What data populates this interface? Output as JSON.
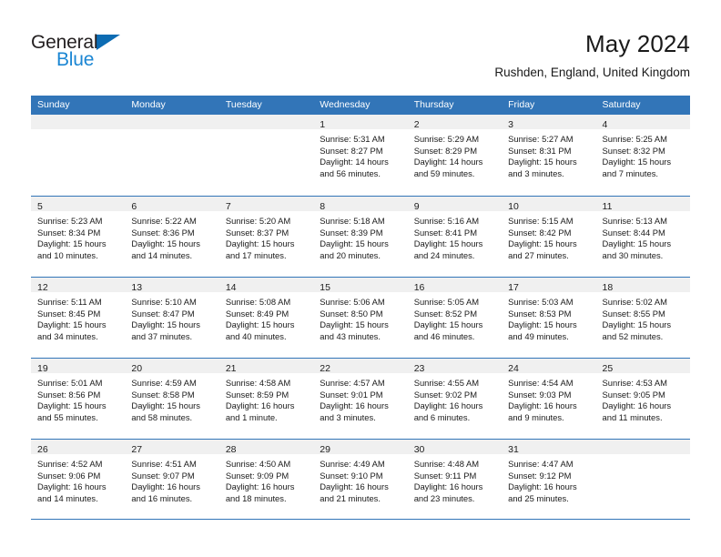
{
  "brand": {
    "line1": "General",
    "line2": "Blue",
    "triangle_color": "#0d6cb3",
    "line2_color": "#1b86d3"
  },
  "header": {
    "title": "May 2024",
    "location": "Rushden, England, United Kingdom"
  },
  "theme": {
    "header_blue": "#3275b8",
    "daynum_band": "#f0f0f0",
    "text": "#1a1a1a"
  },
  "weekday_headers": [
    "Sunday",
    "Monday",
    "Tuesday",
    "Wednesday",
    "Thursday",
    "Friday",
    "Saturday"
  ],
  "weeks": [
    [
      {
        "day": "",
        "sunrise": "",
        "sunset": "",
        "daylight1": "",
        "daylight2": "",
        "empty": true
      },
      {
        "day": "",
        "sunrise": "",
        "sunset": "",
        "daylight1": "",
        "daylight2": "",
        "empty": true
      },
      {
        "day": "",
        "sunrise": "",
        "sunset": "",
        "daylight1": "",
        "daylight2": "",
        "empty": true
      },
      {
        "day": "1",
        "sunrise": "Sunrise: 5:31 AM",
        "sunset": "Sunset: 8:27 PM",
        "daylight1": "Daylight: 14 hours",
        "daylight2": "and 56 minutes."
      },
      {
        "day": "2",
        "sunrise": "Sunrise: 5:29 AM",
        "sunset": "Sunset: 8:29 PM",
        "daylight1": "Daylight: 14 hours",
        "daylight2": "and 59 minutes."
      },
      {
        "day": "3",
        "sunrise": "Sunrise: 5:27 AM",
        "sunset": "Sunset: 8:31 PM",
        "daylight1": "Daylight: 15 hours",
        "daylight2": "and 3 minutes."
      },
      {
        "day": "4",
        "sunrise": "Sunrise: 5:25 AM",
        "sunset": "Sunset: 8:32 PM",
        "daylight1": "Daylight: 15 hours",
        "daylight2": "and 7 minutes."
      }
    ],
    [
      {
        "day": "5",
        "sunrise": "Sunrise: 5:23 AM",
        "sunset": "Sunset: 8:34 PM",
        "daylight1": "Daylight: 15 hours",
        "daylight2": "and 10 minutes."
      },
      {
        "day": "6",
        "sunrise": "Sunrise: 5:22 AM",
        "sunset": "Sunset: 8:36 PM",
        "daylight1": "Daylight: 15 hours",
        "daylight2": "and 14 minutes."
      },
      {
        "day": "7",
        "sunrise": "Sunrise: 5:20 AM",
        "sunset": "Sunset: 8:37 PM",
        "daylight1": "Daylight: 15 hours",
        "daylight2": "and 17 minutes."
      },
      {
        "day": "8",
        "sunrise": "Sunrise: 5:18 AM",
        "sunset": "Sunset: 8:39 PM",
        "daylight1": "Daylight: 15 hours",
        "daylight2": "and 20 minutes."
      },
      {
        "day": "9",
        "sunrise": "Sunrise: 5:16 AM",
        "sunset": "Sunset: 8:41 PM",
        "daylight1": "Daylight: 15 hours",
        "daylight2": "and 24 minutes."
      },
      {
        "day": "10",
        "sunrise": "Sunrise: 5:15 AM",
        "sunset": "Sunset: 8:42 PM",
        "daylight1": "Daylight: 15 hours",
        "daylight2": "and 27 minutes."
      },
      {
        "day": "11",
        "sunrise": "Sunrise: 5:13 AM",
        "sunset": "Sunset: 8:44 PM",
        "daylight1": "Daylight: 15 hours",
        "daylight2": "and 30 minutes."
      }
    ],
    [
      {
        "day": "12",
        "sunrise": "Sunrise: 5:11 AM",
        "sunset": "Sunset: 8:45 PM",
        "daylight1": "Daylight: 15 hours",
        "daylight2": "and 34 minutes."
      },
      {
        "day": "13",
        "sunrise": "Sunrise: 5:10 AM",
        "sunset": "Sunset: 8:47 PM",
        "daylight1": "Daylight: 15 hours",
        "daylight2": "and 37 minutes."
      },
      {
        "day": "14",
        "sunrise": "Sunrise: 5:08 AM",
        "sunset": "Sunset: 8:49 PM",
        "daylight1": "Daylight: 15 hours",
        "daylight2": "and 40 minutes."
      },
      {
        "day": "15",
        "sunrise": "Sunrise: 5:06 AM",
        "sunset": "Sunset: 8:50 PM",
        "daylight1": "Daylight: 15 hours",
        "daylight2": "and 43 minutes."
      },
      {
        "day": "16",
        "sunrise": "Sunrise: 5:05 AM",
        "sunset": "Sunset: 8:52 PM",
        "daylight1": "Daylight: 15 hours",
        "daylight2": "and 46 minutes."
      },
      {
        "day": "17",
        "sunrise": "Sunrise: 5:03 AM",
        "sunset": "Sunset: 8:53 PM",
        "daylight1": "Daylight: 15 hours",
        "daylight2": "and 49 minutes."
      },
      {
        "day": "18",
        "sunrise": "Sunrise: 5:02 AM",
        "sunset": "Sunset: 8:55 PM",
        "daylight1": "Daylight: 15 hours",
        "daylight2": "and 52 minutes."
      }
    ],
    [
      {
        "day": "19",
        "sunrise": "Sunrise: 5:01 AM",
        "sunset": "Sunset: 8:56 PM",
        "daylight1": "Daylight: 15 hours",
        "daylight2": "and 55 minutes."
      },
      {
        "day": "20",
        "sunrise": "Sunrise: 4:59 AM",
        "sunset": "Sunset: 8:58 PM",
        "daylight1": "Daylight: 15 hours",
        "daylight2": "and 58 minutes."
      },
      {
        "day": "21",
        "sunrise": "Sunrise: 4:58 AM",
        "sunset": "Sunset: 8:59 PM",
        "daylight1": "Daylight: 16 hours",
        "daylight2": "and 1 minute."
      },
      {
        "day": "22",
        "sunrise": "Sunrise: 4:57 AM",
        "sunset": "Sunset: 9:01 PM",
        "daylight1": "Daylight: 16 hours",
        "daylight2": "and 3 minutes."
      },
      {
        "day": "23",
        "sunrise": "Sunrise: 4:55 AM",
        "sunset": "Sunset: 9:02 PM",
        "daylight1": "Daylight: 16 hours",
        "daylight2": "and 6 minutes."
      },
      {
        "day": "24",
        "sunrise": "Sunrise: 4:54 AM",
        "sunset": "Sunset: 9:03 PM",
        "daylight1": "Daylight: 16 hours",
        "daylight2": "and 9 minutes."
      },
      {
        "day": "25",
        "sunrise": "Sunrise: 4:53 AM",
        "sunset": "Sunset: 9:05 PM",
        "daylight1": "Daylight: 16 hours",
        "daylight2": "and 11 minutes."
      }
    ],
    [
      {
        "day": "26",
        "sunrise": "Sunrise: 4:52 AM",
        "sunset": "Sunset: 9:06 PM",
        "daylight1": "Daylight: 16 hours",
        "daylight2": "and 14 minutes."
      },
      {
        "day": "27",
        "sunrise": "Sunrise: 4:51 AM",
        "sunset": "Sunset: 9:07 PM",
        "daylight1": "Daylight: 16 hours",
        "daylight2": "and 16 minutes."
      },
      {
        "day": "28",
        "sunrise": "Sunrise: 4:50 AM",
        "sunset": "Sunset: 9:09 PM",
        "daylight1": "Daylight: 16 hours",
        "daylight2": "and 18 minutes."
      },
      {
        "day": "29",
        "sunrise": "Sunrise: 4:49 AM",
        "sunset": "Sunset: 9:10 PM",
        "daylight1": "Daylight: 16 hours",
        "daylight2": "and 21 minutes."
      },
      {
        "day": "30",
        "sunrise": "Sunrise: 4:48 AM",
        "sunset": "Sunset: 9:11 PM",
        "daylight1": "Daylight: 16 hours",
        "daylight2": "and 23 minutes."
      },
      {
        "day": "31",
        "sunrise": "Sunrise: 4:47 AM",
        "sunset": "Sunset: 9:12 PM",
        "daylight1": "Daylight: 16 hours",
        "daylight2": "and 25 minutes."
      },
      {
        "day": "",
        "sunrise": "",
        "sunset": "",
        "daylight1": "",
        "daylight2": "",
        "empty": true
      }
    ]
  ]
}
